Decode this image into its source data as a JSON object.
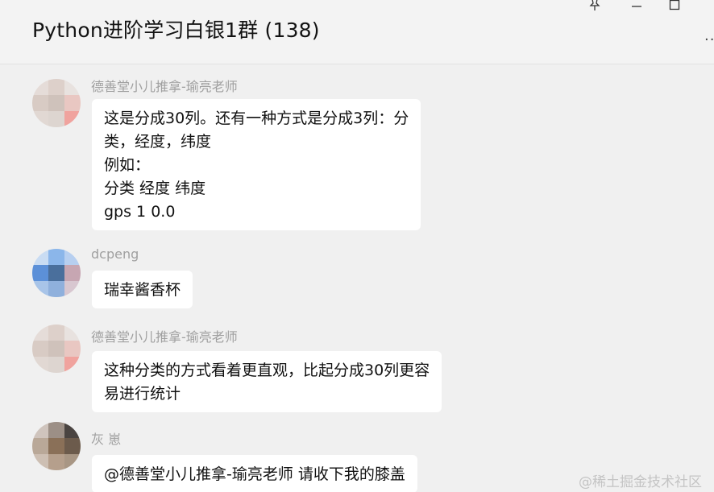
{
  "window": {
    "title": "Python进阶学习白银1群 (138)",
    "controls": {
      "more": ".."
    }
  },
  "messages": [
    {
      "sender": "德善堂小儿推拿-瑜亮老师",
      "lines": [
        "这是分成30列。还有一种方式是分成3列：分",
        "类，经度，纬度",
        "例如：",
        "分类 经度 纬度",
        "gps 1 0.0"
      ]
    },
    {
      "sender": "dcpeng",
      "lines": [
        "瑞幸酱香杯"
      ]
    },
    {
      "sender": "德善堂小儿推拿-瑜亮老师",
      "lines": [
        "这种分类的方式看着更直观，比起分成30列更容",
        "易进行统计"
      ]
    },
    {
      "sender": "灰 崽",
      "lines": [
        "@德善堂小儿推拿-瑜亮老师 请收下我的膝盖"
      ]
    }
  ],
  "watermark": "@稀土掘金技术社区",
  "icons": [
    "pin-icon",
    "minimize-icon",
    "maximize-icon",
    "more-icon"
  ]
}
